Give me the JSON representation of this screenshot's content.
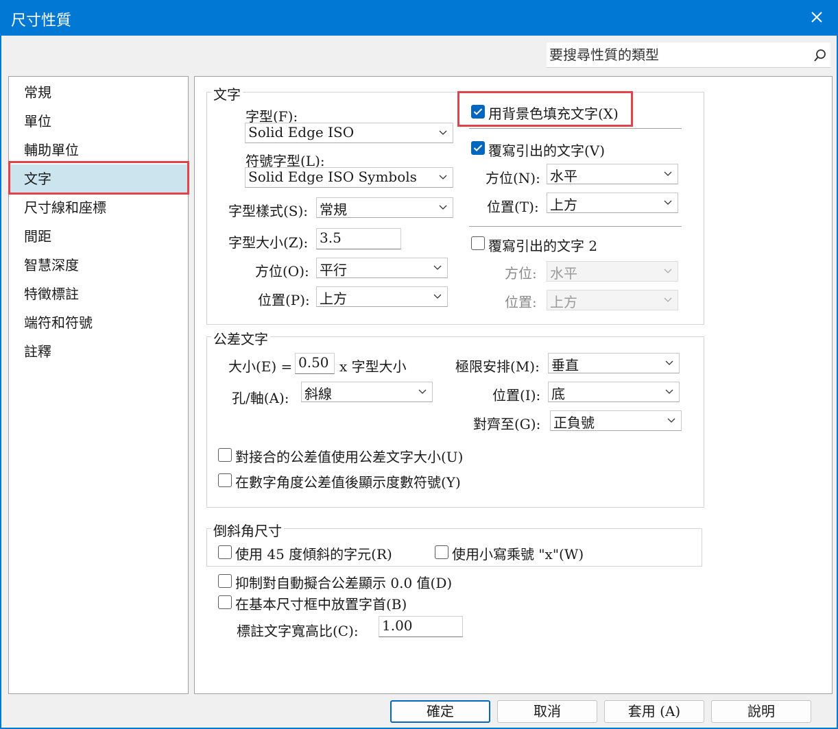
{
  "window": {
    "title": "尺寸性質"
  },
  "search": {
    "placeholder": "要搜尋性質的類型"
  },
  "nav": {
    "items": [
      "常規",
      "單位",
      "輔助單位",
      "文字",
      "尺寸線和座標",
      "間距",
      "智慧深度",
      "特徵標註",
      "端符和符號",
      "註釋"
    ],
    "selected": "文字"
  },
  "text_group": {
    "legend": "文字",
    "font_label": "字型(F):",
    "font_value": "Solid Edge ISO",
    "symbol_font_label": "符號字型(L):",
    "symbol_font_value": "Solid Edge ISO Symbols",
    "style_label": "字型樣式(S):",
    "style_value": "常規",
    "size_label": "字型大小(Z):",
    "size_value": "3.5",
    "orientation_label": "方位(O):",
    "orientation_value": "平行",
    "position_label": "位置(P):",
    "position_value": "上方",
    "fill_bg_label": "用背景色填充文字(X)",
    "fill_bg_checked": true,
    "override_label": "覆寫引出的文字(V)",
    "override_checked": true,
    "ov_orientation_label": "方位(N):",
    "ov_orientation_value": "水平",
    "ov_position_label": "位置(T):",
    "ov_position_value": "上方",
    "override2_label": "覆寫引出的文字 2",
    "override2_checked": false,
    "ov2_orientation_label": "方位:",
    "ov2_orientation_value": "水平",
    "ov2_position_label": "位置:",
    "ov2_position_value": "上方"
  },
  "tolerance_group": {
    "legend": "公差文字",
    "size_label": "大小(E) =",
    "size_value": "0.50",
    "size_suffix": "x 字型大小",
    "hole_shaft_label": "孔/軸(A):",
    "hole_shaft_value": "斜線",
    "limit_label": "極限安排(M):",
    "limit_value": "垂直",
    "position_label": "位置(I):",
    "position_value": "底",
    "align_label": "對齊至(G):",
    "align_value": "正負號",
    "check1_label": "對接合的公差值使用公差文字大小(U)",
    "check2_label": "在數字角度公差值後顯示度數符號(Y)"
  },
  "chamfer_group": {
    "legend": "倒斜角尺寸",
    "check1_label": "使用 45 度傾斜的字元(R)",
    "check2_label": "使用小寫乘號 \"x\"(W)"
  },
  "misc": {
    "suppress_label": "抑制對自動擬合公差顯示 0.0 值(D)",
    "prefix_label": "在基本尺寸框中放置字首(B)",
    "aspect_label": "標註文字寬高比(C):",
    "aspect_value": "1.00"
  },
  "buttons": {
    "ok": "確定",
    "cancel": "取消",
    "apply": "套用 (A)",
    "help": "說明"
  },
  "colors": {
    "titlebar": "#0078d4",
    "highlight_box": "#e0434a",
    "selected_nav": "#cce4ee",
    "checkbox_on": "#0067c0"
  }
}
